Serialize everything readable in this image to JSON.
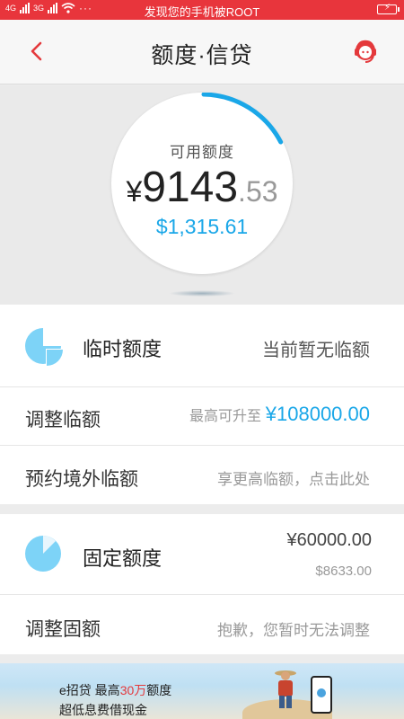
{
  "status_bar": {
    "network_left": "4G",
    "network_left2": "3G",
    "message": "发现您的手机被ROOT"
  },
  "nav": {
    "title": "额度·信贷",
    "back_icon": "chevron-left-icon",
    "service_icon": "customer-service-icon"
  },
  "balance": {
    "label": "可用额度",
    "currency": "¥",
    "integer": "9143",
    "decimal": ".53",
    "usd": "$1,315.61",
    "progress_fraction": 0.17,
    "accent": "#1aa7e8"
  },
  "temp_limit": {
    "title": "临时额度",
    "status": "当前暂无临额",
    "icon": "pie-quarter-icon"
  },
  "adjust_temp": {
    "label": "调整临额",
    "hint": "最高可升至",
    "amount": "¥108000.00"
  },
  "overseas": {
    "label": "预约境外临额",
    "hint": "享更高临额，点击此处"
  },
  "fixed_limit": {
    "title": "固定额度",
    "amount": "¥60000.00",
    "usd": "$8633.00",
    "icon": "pie-chart-icon"
  },
  "adjust_fixed": {
    "label": "调整固额",
    "hint": "抱歉，您暂时无法调整"
  },
  "banner": {
    "line1_prefix": "e招贷  最高",
    "line1_highlight": "30万",
    "line1_suffix": "额度",
    "line2": "超低息费借现金"
  }
}
